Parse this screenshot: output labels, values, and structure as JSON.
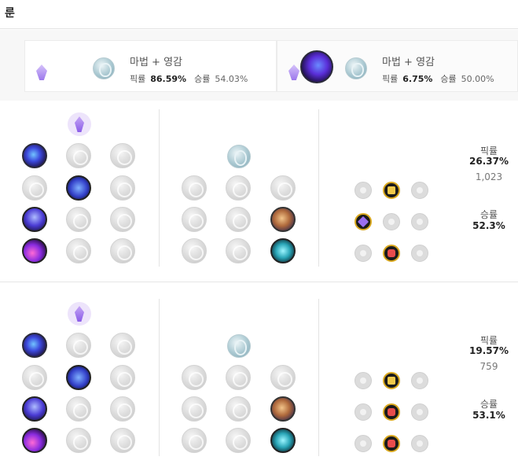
{
  "header": {
    "title": "룬"
  },
  "summary": {
    "tabs": [
      {
        "name": "마법 + 영감",
        "pick_label": "픽률",
        "pick_rate": "86.59%",
        "win_label": "승률",
        "win_rate": "54.03%",
        "selected": true
      },
      {
        "name": "마법 + 영감",
        "pick_label": "픽률",
        "pick_rate": "6.75%",
        "win_label": "승률",
        "win_rate": "50.00%",
        "selected": false
      }
    ]
  },
  "builds": [
    {
      "pick_label": "픽률",
      "pick_rate": "26.37%",
      "games": "1,023",
      "win_label": "승률",
      "win_rate": "52.3%"
    },
    {
      "pick_label": "픽률",
      "pick_rate": "19.57%",
      "games": "759",
      "win_label": "승률",
      "win_rate": "53.1%"
    }
  ],
  "icons": {
    "primary_tree": "sorcery-icon",
    "secondary_tree": "inspiration-icon",
    "keystones": [
      "summon-aery-icon",
      "arcane-comet-icon",
      "phase-rush-icon"
    ],
    "row1": [
      "nullifying-orb-icon",
      "manaflow-band-icon",
      "nimbus-cloak-icon"
    ],
    "row2": [
      "transcendence-icon",
      "celerity-icon",
      "absolute-focus-icon"
    ],
    "row3": [
      "scorch-icon",
      "waterwalking-icon",
      "gathering-storm-icon"
    ]
  },
  "colors": {
    "accent_gold": "#d9a81e",
    "sorcery_purple": "#9a6ef0",
    "divider": "#e3e3e3"
  }
}
